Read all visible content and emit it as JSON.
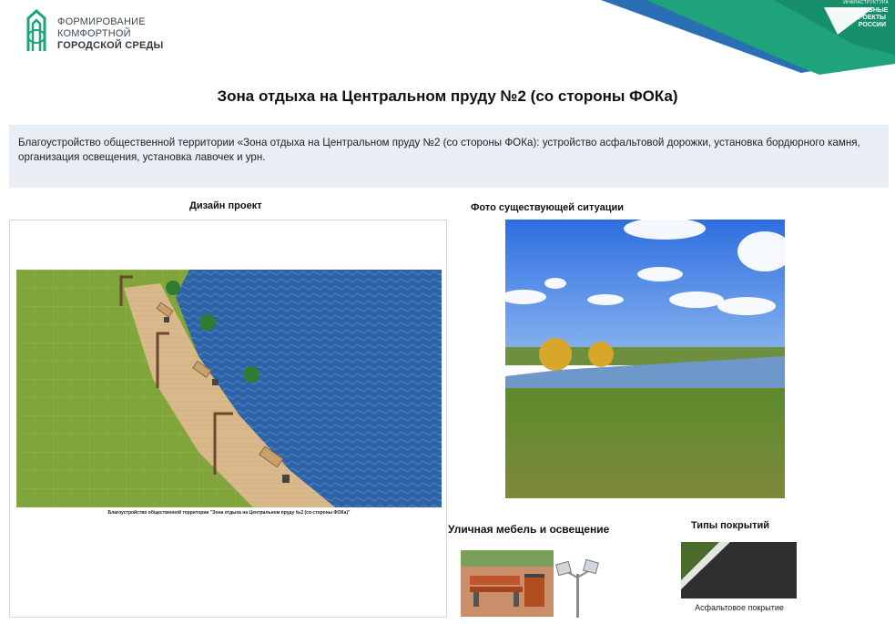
{
  "header": {
    "logo_left": {
      "line1": "ФОРМИРОВАНИЕ",
      "line2": "КОМФОРТНОЙ",
      "line3": "ГОРОДСКОЙ СРЕДЫ"
    },
    "logo_right": {
      "topline": "ИНФРАСТРУКТУРА",
      "line1": "НАЦИОНАЛЬНЫЕ",
      "line2": "ПРОЕКТЫ",
      "line3": "РОССИИ"
    },
    "colors": {
      "brand_green": "#1fa37a",
      "brand_blue": "#2a6fb3",
      "desc_bg": "#e9edf4"
    }
  },
  "title": "Зона отдыха на Центральном пруду №2 (со стороны ФОКа)",
  "description": "Благоустройство общественной территории «Зона отдыха на Центральном пруду №2 (со стороны ФОКа): устройство асфальтовой дорожки, установка бордюрного камня, организация освещения, установка лавочек и урн.",
  "design": {
    "label": "Дизайн проект",
    "caption": "Благоустройство общественной территории \"Зона отдыха на Центральном пруду №2 (со стороны ФОКа)\""
  },
  "photo": {
    "label": "Фото существующей ситуации"
  },
  "furniture": {
    "label": "Уличная мебель и освещение"
  },
  "surfaces": {
    "label": "Типы покрытий",
    "caption": "Асфальтовое покрытие"
  }
}
